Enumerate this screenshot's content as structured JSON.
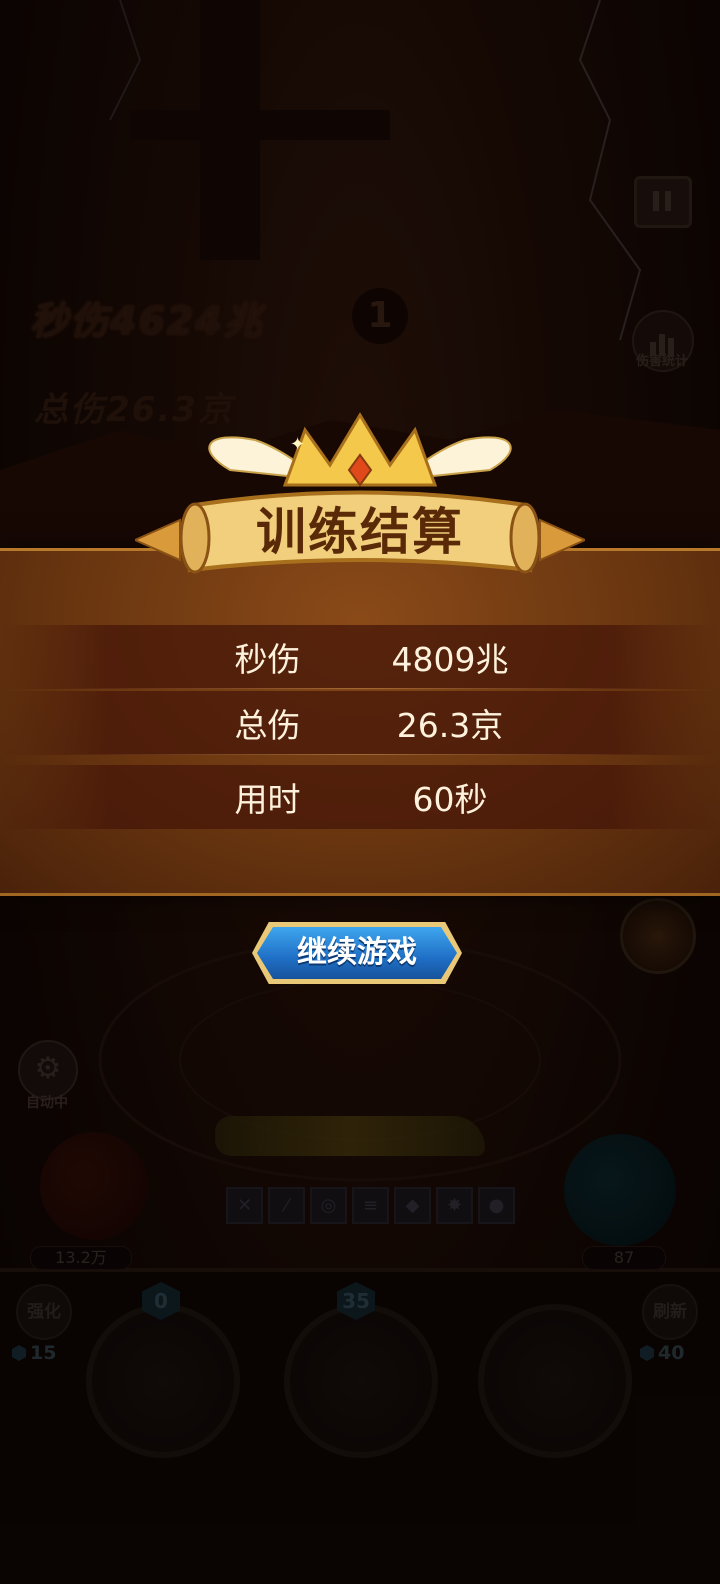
{
  "background": {
    "dps_label": "秒伤4624兆",
    "total_label": "总伤26.3京",
    "timer_value": "1",
    "stats_button_label": "伤害统计",
    "auto_label": "自动中",
    "hp_value": "13.2万",
    "mp_value": "87",
    "enhance_label": "强化",
    "enhance_cost": "15",
    "refresh_label": "刷新",
    "refresh_cost": "40",
    "slots": [
      {
        "badge": "0",
        "icon": "potion-icon"
      },
      {
        "badge": "35",
        "icon": "hero-icon"
      },
      {
        "badge": "",
        "icon": "lock-icon"
      }
    ],
    "skills": [
      "sword-icon",
      "slash-icon",
      "swirl-icon",
      "claw-icon",
      "beast-icon",
      "burst-icon",
      "orb-icon"
    ]
  },
  "modal": {
    "title": "训练结算",
    "rows": [
      {
        "label": "秒伤",
        "value": "4809兆"
      },
      {
        "label": "总伤",
        "value": "26.3京"
      },
      {
        "label": "用时",
        "value": "60秒"
      }
    ],
    "continue_button": "继续游戏"
  },
  "colors": {
    "panel": "#6a3610",
    "button": "#1f6fc6",
    "text": "#fff2dc",
    "gold": "#f3c850"
  }
}
